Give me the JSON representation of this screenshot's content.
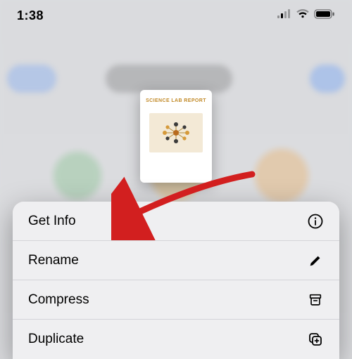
{
  "status_bar": {
    "time": "1:38"
  },
  "file_preview": {
    "title": "SCIENCE LAB REPORT"
  },
  "menu": {
    "items": [
      {
        "label": "Get Info",
        "icon": "info-circle-icon"
      },
      {
        "label": "Rename",
        "icon": "pencil-icon"
      },
      {
        "label": "Compress",
        "icon": "archivebox-icon"
      },
      {
        "label": "Duplicate",
        "icon": "plus-on-square-icon"
      }
    ]
  }
}
